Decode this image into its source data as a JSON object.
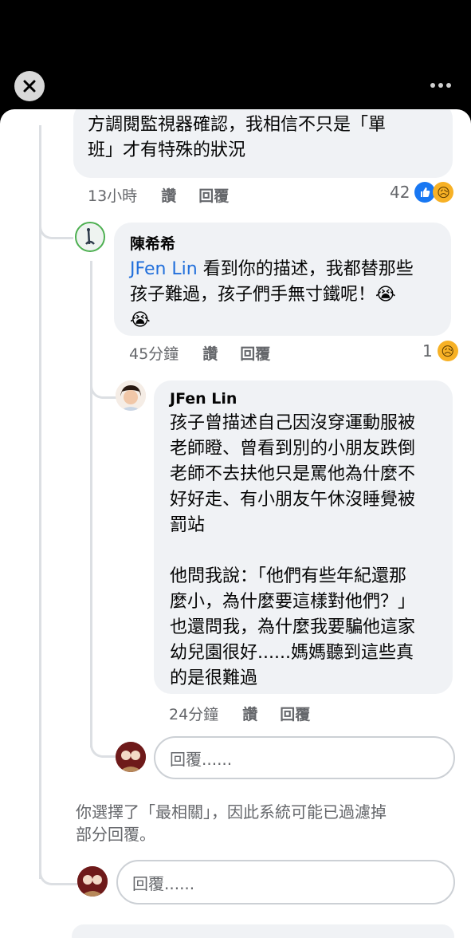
{
  "top": {
    "close_icon": "close-icon",
    "more_icon": "more-horizontal-icon"
  },
  "comment1": {
    "text": "方調閱監視器確認，我相信不只是「單\n班」才有特殊的狀況",
    "time": "13小時",
    "like_label": "讚",
    "reply_label": "回覆",
    "reaction_count": "42",
    "reaction_icons": [
      "like-icon",
      "sad-icon"
    ]
  },
  "comment2": {
    "author": "陳希希",
    "mention": "JFen Lin",
    "text": " 看到你的描述，我都替那些\n孩子難過，孩子們手無寸鐵呢！😭\n😭",
    "time": "45分鐘",
    "like_label": "讚",
    "reply_label": "回覆",
    "reaction_count": "1",
    "reaction_icons": [
      "sad-icon"
    ]
  },
  "comment3": {
    "author": "JFen Lin",
    "text": "孩子曾描述自己因沒穿運動服被\n老師瞪、曾看到別的小朋友跌倒\n老師不去扶他只是罵他為什麼不\n好好走、有小朋友午休沒睡覺被\n罰站\n\n他問我說：「他們有些年紀還那\n麼小，為什麼要這樣對他們？」\n也還問我，為什麼我要騙他這家\n幼兒園很好......媽媽聽到這些真\n的是很難過",
    "time": "24分鐘",
    "like_label": "讚",
    "reply_label": "回覆"
  },
  "reply_inner": {
    "placeholder": "回覆......"
  },
  "notice": "你選擇了「最相關」，因此系統可能已過濾掉\n部分回覆。",
  "reply_outer": {
    "placeholder": "回覆......"
  },
  "colors": {
    "link": "#216fdb",
    "bubble": "#f0f2f5",
    "meta": "#65676b",
    "like": "#1877f2",
    "sad": "#f7b125"
  }
}
